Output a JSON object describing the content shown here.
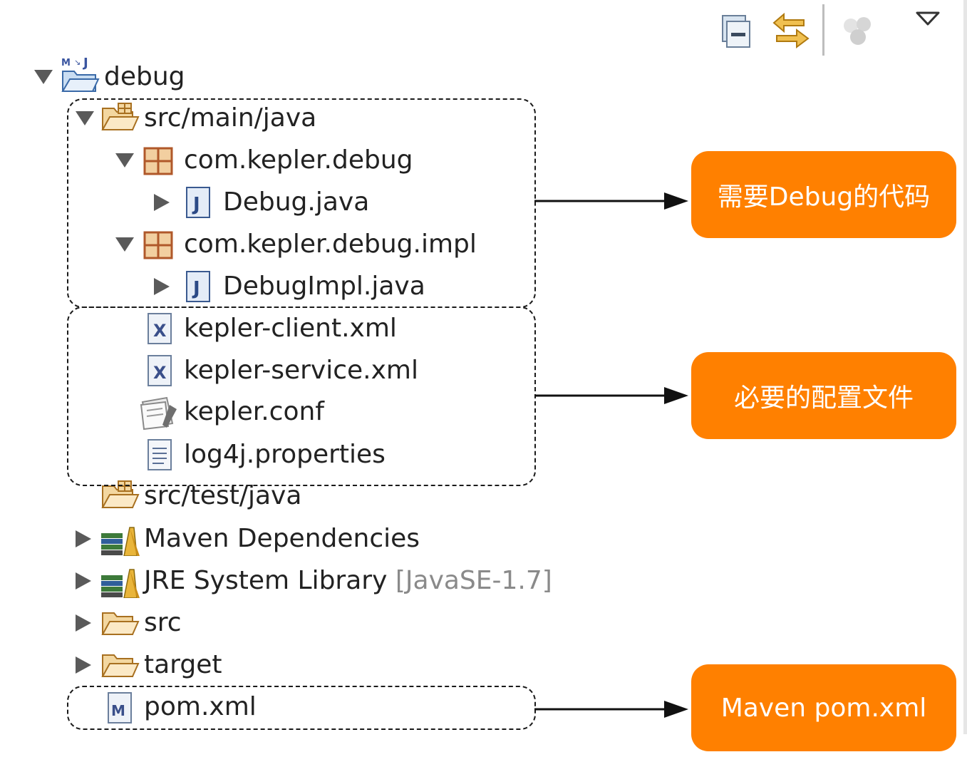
{
  "toolbar": {
    "buttons": [
      {
        "name": "collapse-all-icon"
      },
      {
        "name": "link-with-editor-icon"
      },
      {
        "name": "filter-icon"
      },
      {
        "name": "view-menu-icon"
      }
    ]
  },
  "tree": {
    "project": "debug",
    "src_main_java": "src/main/java",
    "pkg_debug": "com.kepler.debug",
    "file_debug": "Debug.java",
    "pkg_impl": "com.kepler.debug.impl",
    "file_impl": "DebugImpl.java",
    "client_xml": "kepler-client.xml",
    "service_xml": "kepler-service.xml",
    "conf": "kepler.conf",
    "props": "log4j.properties",
    "src_test_java": "src/test/java",
    "maven_deps": "Maven Dependencies",
    "jre_lib": "JRE System Library",
    "jre_version": "[JavaSE-1.7]",
    "src": "src",
    "target": "target",
    "pom": "pom.xml"
  },
  "annotations": {
    "code": "需要Debug的代码",
    "config": "必要的配置文件",
    "pom": "Maven pom.xml"
  },
  "colors": {
    "callout": "#ff8000",
    "callout_text": "#ffffff"
  }
}
